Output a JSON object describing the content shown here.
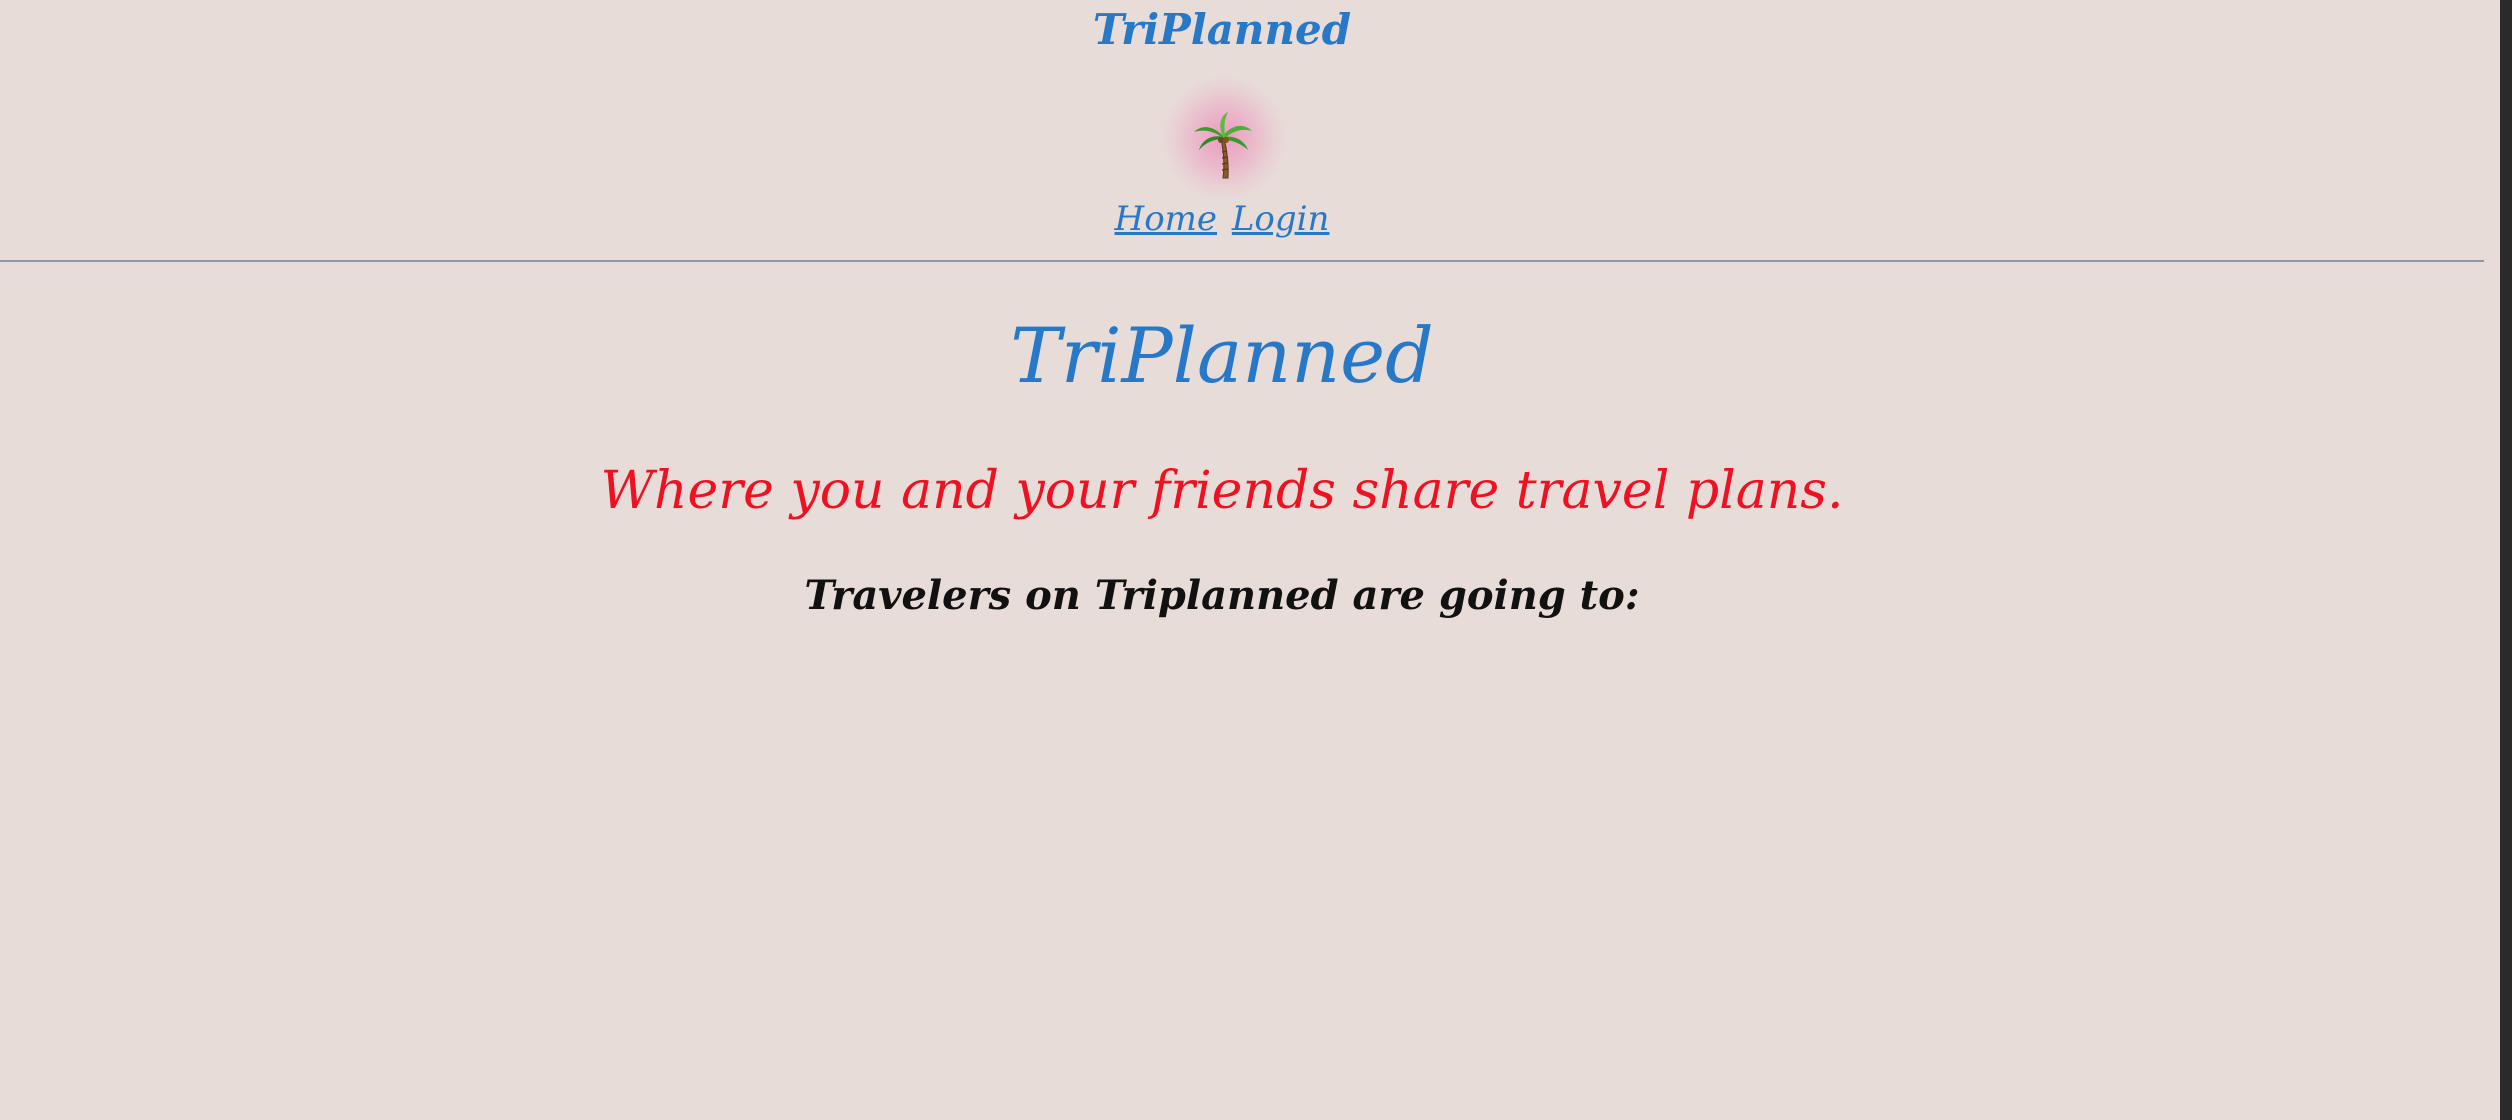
{
  "header": {
    "brand": "TriPlanned",
    "logo_icon": "palm-tree-icon",
    "nav": {
      "home_label": "Home",
      "login_label": "Login"
    }
  },
  "main": {
    "title": "TriPlanned",
    "tagline": "Where you and your friends share travel plans.",
    "subhead": "Travelers on Triplanned are going to:"
  },
  "colors": {
    "background": "#e8dcd8",
    "brand_blue": "#2878c8",
    "tagline_red": "#ee1122",
    "text": "#111111",
    "logo_glow": "#ec96be"
  }
}
